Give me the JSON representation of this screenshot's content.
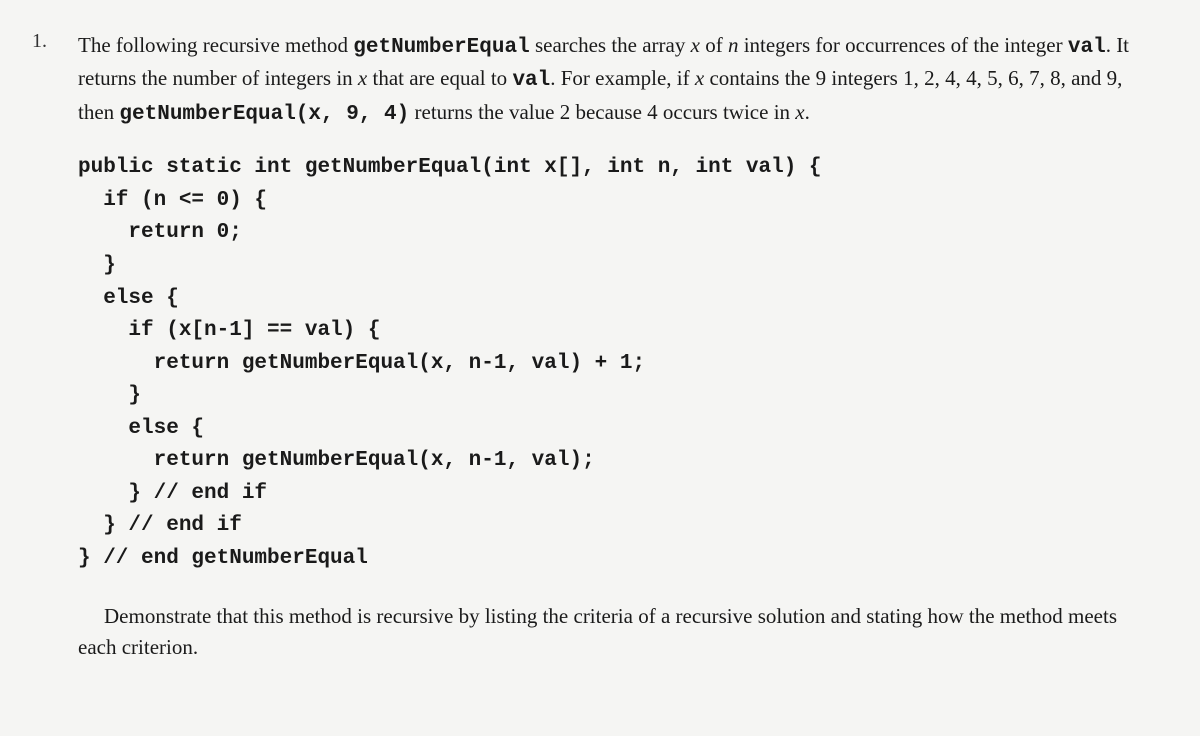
{
  "problem": {
    "number": "1.",
    "intro_html": "The following recursive method <span class='code-inline'>getNumberEqual</span> searches the array <span class='italic'>x</span> of <span class='italic'>n</span> integers for occurrences of the integer <span class='code-inline'>val</span>. It returns the number of integers in <span class='italic'>x</span> that are equal to <span class='code-inline'>val</span>. For example, if <span class='italic'>x</span> contains the 9 integers 1, 2, 4, 4, 5, 6, 7, 8, and 9, then <span class='code-inline'>getNumberEqual(x, 9, 4)</span> returns the value 2 because 4 occurs twice in <span class='italic'>x</span>.",
    "code": "public static int getNumberEqual(int x[], int n, int val) {\n  if (n <= 0) {\n    return 0;\n  }\n  else {\n    if (x[n-1] == val) {\n      return getNumberEqual(x, n-1, val) + 1;\n    }\n    else {\n      return getNumberEqual(x, n-1, val);\n    } // end if\n  } // end if\n} // end getNumberEqual",
    "conclusion": "Demonstrate that this method is recursive by listing the criteria of a recursive solution and stating how the method meets each criterion."
  }
}
